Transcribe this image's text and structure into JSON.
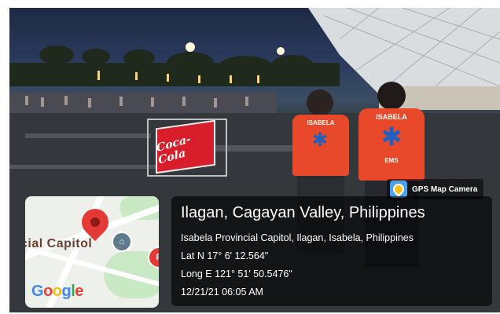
{
  "photo": {
    "sign_text": "Coca-Cola",
    "vest_left": {
      "org": "ISABELA"
    },
    "vest_right": {
      "org": "ISABELA",
      "unit": "EMS"
    }
  },
  "gps_badge": {
    "label": "GPS Map Camera",
    "icon": "map-pin-camera-icon"
  },
  "map": {
    "place_label": "cial Capitol",
    "brand": "Google",
    "pin_icon": "location-pin-icon",
    "poi_icon": "landmark-icon"
  },
  "location": {
    "title": "Ilagan, Cagayan Valley, Philippines",
    "address": "Isabela Provincial Capitol, Ilagan, Isabela, Philippines",
    "latitude": "Lat N 17° 6' 12.564\"",
    "longitude": "Long E 121° 51' 50.5476\"",
    "timestamp": "12/21/21 06:05 AM"
  },
  "colors": {
    "vest_orange": "#e8492a",
    "star_blue": "#1f5fbf",
    "pin_red": "#e53935"
  }
}
